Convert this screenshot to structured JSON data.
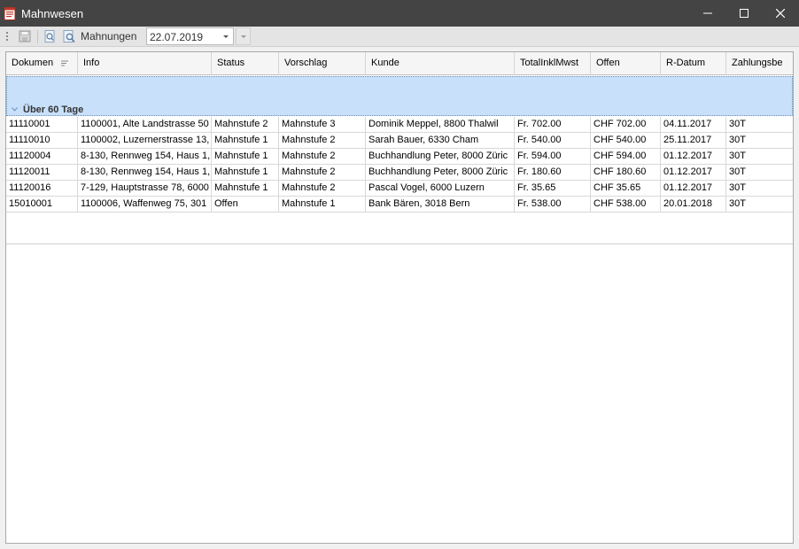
{
  "window": {
    "title": "Mahnwesen",
    "icon": "document-red-icon"
  },
  "toolbar": {
    "label": "Mahnungen",
    "date_value": "22.07.2019",
    "icons": [
      "save-icon",
      "preview-icon",
      "search-preview-icon"
    ]
  },
  "grid": {
    "columns": [
      "Dokumen",
      "Info",
      "Status",
      "Vorschlag",
      "Kunde",
      "TotalInklMwst",
      "Offen",
      "R-Datum",
      "Zahlungsbe"
    ],
    "group_label": "Über 60 Tage",
    "rows": [
      [
        "11110001",
        "1100001, Alte Landstrasse 50",
        "Mahnstufe 2",
        "Mahnstufe 3",
        "Dominik Meppel, 8800 Thalwil",
        "Fr. 702.00",
        "CHF 702.00",
        "04.11.2017",
        "30T"
      ],
      [
        "11110010",
        "1100002, Luzernerstrasse 13,",
        "Mahnstufe 1",
        "Mahnstufe 2",
        "Sarah Bauer, 6330 Cham",
        "Fr. 540.00",
        "CHF 540.00",
        "25.11.2017",
        "30T"
      ],
      [
        "11120004",
        "8-130, Rennweg 154, Haus 1,",
        "Mahnstufe 1",
        "Mahnstufe 2",
        "Buchhandlung Peter, 8000 Züric",
        "Fr. 594.00",
        "CHF 594.00",
        "01.12.2017",
        "30T"
      ],
      [
        "11120011",
        "8-130, Rennweg 154, Haus 1,",
        "Mahnstufe 1",
        "Mahnstufe 2",
        "Buchhandlung Peter, 8000 Züric",
        "Fr. 180.60",
        "CHF 180.60",
        "01.12.2017",
        "30T"
      ],
      [
        "11120016",
        "7-129, Hauptstrasse 78, 6000",
        "Mahnstufe 1",
        "Mahnstufe 2",
        "Pascal Vogel, 6000 Luzern",
        "Fr. 35.65",
        "CHF 35.65",
        "01.12.2017",
        "30T"
      ],
      [
        "15010001",
        "1100006, Waffenweg 75, 301",
        "Offen",
        "Mahnstufe 1",
        "Bank Bären, 3018 Bern",
        "Fr. 538.00",
        "CHF 538.00",
        "20.01.2018",
        "30T"
      ]
    ]
  },
  "colors": {
    "titlebar": "#444444",
    "group_band": "#c8e0fa",
    "app_icon_red": "#c0392b"
  }
}
